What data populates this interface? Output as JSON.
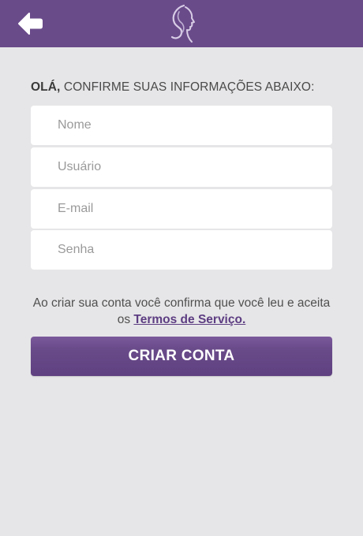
{
  "header": {
    "back_icon": "arrow-left-icon",
    "logo_icon": "woman-profile-logo-icon"
  },
  "form": {
    "greeting_strong": "OLÁ,",
    "greeting_rest": " CONFIRME SUAS INFORMAÇÕES ABAIXO:",
    "fields": [
      {
        "placeholder": "Nome",
        "value": ""
      },
      {
        "placeholder": "Usuário",
        "value": ""
      },
      {
        "placeholder": "E-mail",
        "value": ""
      },
      {
        "placeholder": "Senha",
        "value": ""
      }
    ]
  },
  "terms": {
    "text": "Ao criar sua conta você confirma que você leu e aceita os ",
    "link": "Termos de Serviço."
  },
  "actions": {
    "create_account": "CRIAR CONTA"
  },
  "colors": {
    "brand": "#6a4b8a",
    "background": "#e6e6e8",
    "link": "#5d3d82"
  }
}
